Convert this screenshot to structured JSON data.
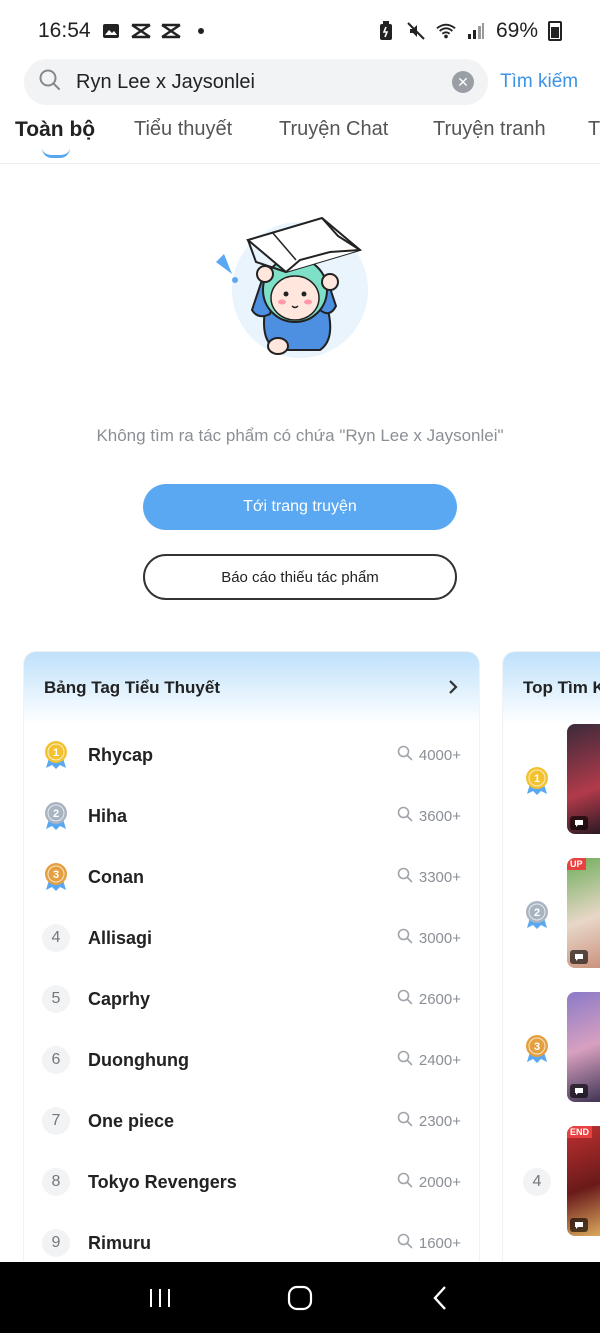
{
  "status_bar": {
    "time": "16:54",
    "battery": "69%",
    "icons": [
      "image-icon",
      "capcut-icon",
      "capcut-icon",
      "dot-icon",
      "battery-saver-icon",
      "mute-icon",
      "wifi-icon",
      "signal-icon",
      "battery-icon"
    ]
  },
  "search": {
    "value": "Ryn Lee x Jaysonlei",
    "submit_label": "Tìm kiếm"
  },
  "tabs": [
    {
      "label": "Toàn bộ",
      "active": true
    },
    {
      "label": "Tiểu thuyết"
    },
    {
      "label": "Truyện Chat"
    },
    {
      "label": "Truyện tranh"
    },
    {
      "label": "T"
    }
  ],
  "empty_state": {
    "message": "Không tìm ra tác phẩm có chứa \"Ryn Lee x Jaysonlei\"",
    "primary_button": "Tới trang truyện",
    "secondary_button": "Báo cáo thiếu tác phẩm"
  },
  "tag_board": {
    "title": "Bảng Tag Tiểu Thuyết",
    "items": [
      {
        "rank": "1",
        "name": "Rhycap",
        "count": "4000+"
      },
      {
        "rank": "2",
        "name": "Hiha",
        "count": "3600+"
      },
      {
        "rank": "3",
        "name": "Conan",
        "count": "3300+"
      },
      {
        "rank": "4",
        "name": "Allisagi",
        "count": "3000+"
      },
      {
        "rank": "5",
        "name": "Caprhy",
        "count": "2600+"
      },
      {
        "rank": "6",
        "name": "Duonghung",
        "count": "2400+"
      },
      {
        "rank": "7",
        "name": "One piece",
        "count": "2300+"
      },
      {
        "rank": "8",
        "name": "Tokyo Revengers",
        "count": "2000+"
      },
      {
        "rank": "9",
        "name": "Rimuru",
        "count": "1600+"
      }
    ]
  },
  "top_search": {
    "title": "Top Tìm K",
    "items": [
      {
        "rank": "1",
        "label": ""
      },
      {
        "rank": "2",
        "label": "UP"
      },
      {
        "rank": "3",
        "label": ""
      },
      {
        "rank": "4",
        "label": "END"
      }
    ]
  },
  "colors": {
    "accent": "#3c93e6",
    "primary_button": "#5aa8f2",
    "gold": "#f2c230",
    "silver": "#a9b4c2",
    "bronze": "#e4a040"
  }
}
